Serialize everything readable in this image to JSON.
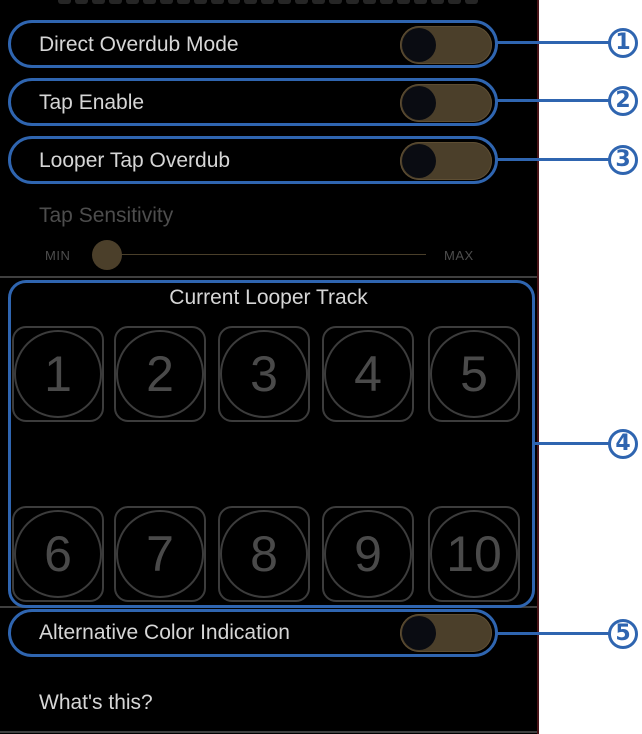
{
  "settings": {
    "direct_overdub": {
      "label": "Direct Overdub Mode",
      "on": false
    },
    "tap_enable": {
      "label": "Tap Enable",
      "on": false
    },
    "looper_tap_overdub": {
      "label": "Looper Tap Overdub",
      "on": false
    },
    "tap_sensitivity": {
      "label": "Tap Sensitivity",
      "min_label": "MIN",
      "max_label": "MAX",
      "value_fraction": 0.0
    },
    "alt_color": {
      "label": "Alternative Color Indication",
      "on": false
    },
    "whats_this": "What's this?"
  },
  "looper": {
    "title": "Current Looper Track",
    "tracks": [
      "1",
      "2",
      "3",
      "4",
      "5",
      "6",
      "7",
      "8",
      "9",
      "10"
    ]
  },
  "callouts": [
    "1",
    "2",
    "3",
    "4",
    "5"
  ],
  "colors": {
    "callout": "#2f65b0",
    "toggle_track": "#4b3f2a",
    "background": "#000000"
  }
}
